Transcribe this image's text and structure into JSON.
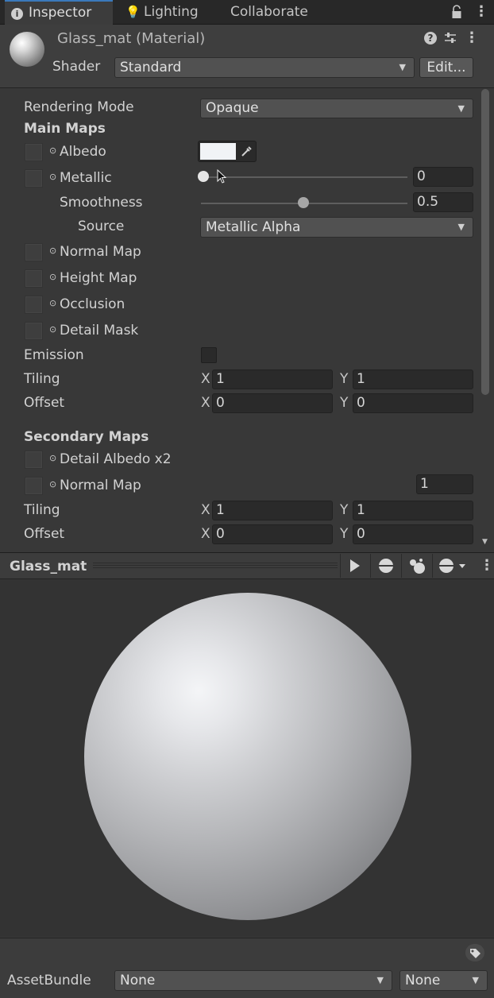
{
  "tabs": [
    {
      "label": "Inspector"
    },
    {
      "label": "Lighting"
    },
    {
      "label": "Collaborate"
    }
  ],
  "header": {
    "title": "Glass_mat (Material)",
    "shader_label": "Shader",
    "shader_value": "Standard",
    "edit_label": "Edit..."
  },
  "properties": {
    "rendering_mode_label": "Rendering Mode",
    "rendering_mode_value": "Opaque",
    "main_maps_heading": "Main Maps",
    "albedo_label": "Albedo",
    "albedo_color": "#f1f3f6",
    "metallic_label": "Metallic",
    "metallic_value": "0",
    "smoothness_label": "Smoothness",
    "smoothness_value": "0.5",
    "source_label": "Source",
    "source_value": "Metallic Alpha",
    "normal_map_label": "Normal Map",
    "height_map_label": "Height Map",
    "occlusion_label": "Occlusion",
    "detail_mask_label": "Detail Mask",
    "emission_label": "Emission",
    "tiling_label": "Tiling",
    "tiling_x": "1",
    "tiling_y": "1",
    "offset_label": "Offset",
    "offset_x": "0",
    "offset_y": "0",
    "x_label": "X",
    "y_label": "Y",
    "secondary_maps_heading": "Secondary Maps",
    "detail_albedo_label": "Detail Albedo x2",
    "secondary_normal_map_label": "Normal Map",
    "secondary_normal_value": "1",
    "secondary_tiling_x": "1",
    "secondary_tiling_y": "1",
    "secondary_offset_x": "0",
    "secondary_offset_y": "0"
  },
  "preview": {
    "title": "Glass_mat"
  },
  "footer": {
    "assetbundle_label": "AssetBundle",
    "bundle_name": "None",
    "bundle_variant": "None"
  },
  "colors": {
    "accent": "#3a79bb",
    "panel_bg": "#383838"
  }
}
